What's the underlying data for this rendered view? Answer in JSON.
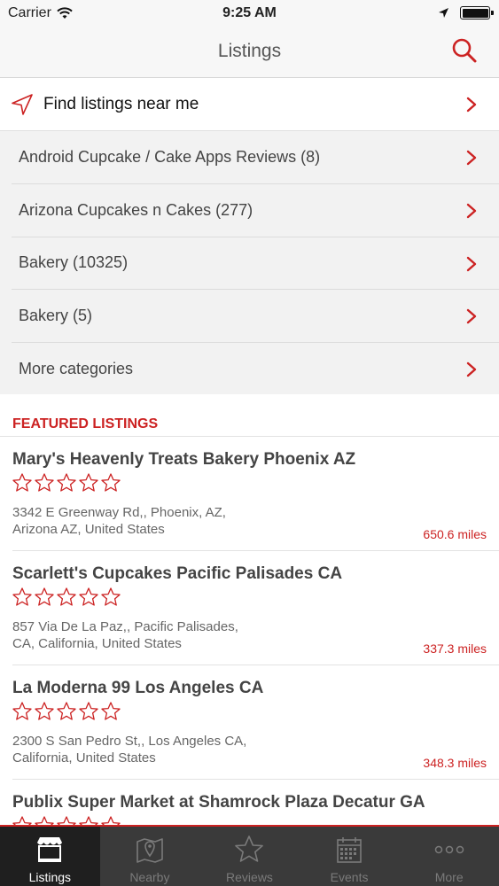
{
  "status_bar": {
    "carrier": "Carrier",
    "time": "9:25 AM"
  },
  "nav": {
    "title": "Listings"
  },
  "find_nearby": {
    "label": "Find listings near me"
  },
  "categories": [
    {
      "label": "Android Cupcake / Cake Apps Reviews (8)"
    },
    {
      "label": "Arizona Cupcakes n Cakes (277)"
    },
    {
      "label": "Bakery (10325)"
    },
    {
      "label": "Bakery (5)"
    },
    {
      "label": "More categories"
    }
  ],
  "featured": {
    "header": "FEATURED LISTINGS",
    "listings": [
      {
        "name": "Mary's Heavenly Treats Bakery Phoenix AZ",
        "rating": 0,
        "address_line1": "3342 E Greenway Rd,, Phoenix, AZ,",
        "address_line2": "Arizona AZ, United States",
        "distance": "650.6 miles"
      },
      {
        "name": "Scarlett's Cupcakes Pacific Palisades CA",
        "rating": 0,
        "address_line1": "857 Via De La Paz,, Pacific Palisades,",
        "address_line2": "CA, California, United States",
        "distance": "337.3 miles"
      },
      {
        "name": "La Moderna 99 Los Angeles CA",
        "rating": 0,
        "address_line1": "2300 S San Pedro St,, Los Angeles CA,",
        "address_line2": "California, United States",
        "distance": "348.3 miles"
      },
      {
        "name": "Publix Super Market at Shamrock Plaza Decatur GA",
        "rating": 0,
        "address_line1": "",
        "address_line2": "",
        "distance": ""
      }
    ]
  },
  "tabs": [
    {
      "label": "Listings",
      "icon": "storefront-icon",
      "active": true
    },
    {
      "label": "Nearby",
      "icon": "map-pin-icon",
      "active": false
    },
    {
      "label": "Reviews",
      "icon": "star-icon",
      "active": false
    },
    {
      "label": "Events",
      "icon": "calendar-icon",
      "active": false
    },
    {
      "label": "More",
      "icon": "more-dots-icon",
      "active": false
    }
  ],
  "colors": {
    "accent": "#cc2222",
    "tab_bar": "#3a3a3a",
    "tab_active": "#1f1f1f"
  }
}
